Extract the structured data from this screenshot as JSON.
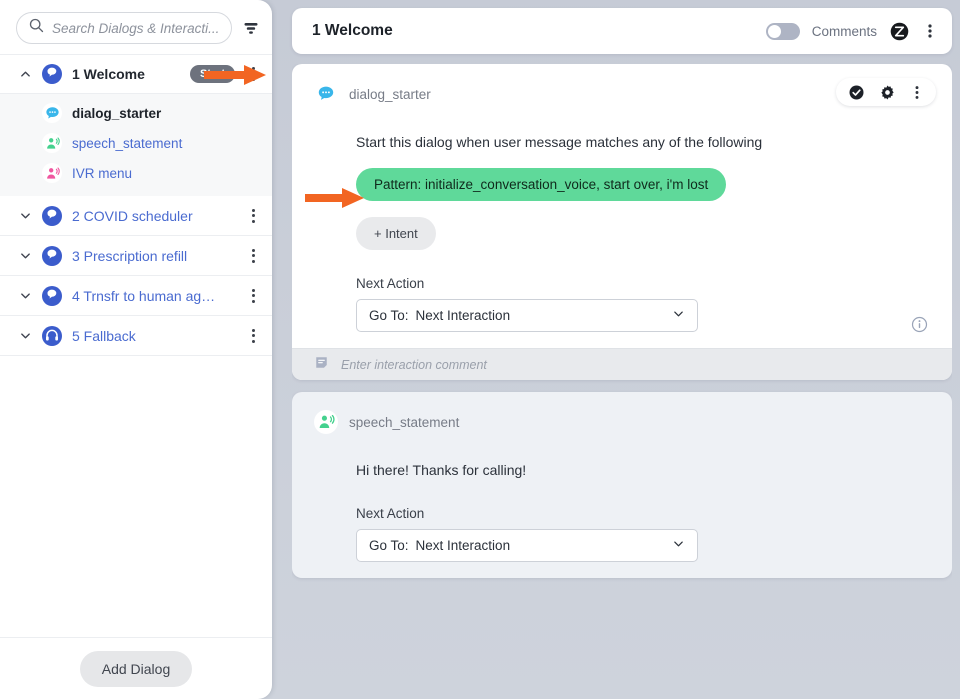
{
  "search": {
    "placeholder": "Search Dialogs & Interacti...",
    "filter_icon": "filter-icon",
    "search_icon": "search-icon"
  },
  "sidebar": {
    "dialogs": [
      {
        "label": "1 Welcome",
        "badge": "Start",
        "expanded": true,
        "icon": "dialog-bubble-icon",
        "children": [
          {
            "label": "dialog_starter",
            "icon": "speech-bubble-blue-icon",
            "selected": true
          },
          {
            "label": "speech_statement",
            "icon": "speaker-person-green-icon",
            "selected": false
          },
          {
            "label": "IVR menu",
            "icon": "speaker-person-pink-icon",
            "selected": false
          }
        ]
      },
      {
        "label": "2 COVID scheduler",
        "badge": "",
        "expanded": false,
        "icon": "dialog-bubble-icon",
        "children": []
      },
      {
        "label": "3 Prescription refill",
        "badge": "",
        "expanded": false,
        "icon": "dialog-bubble-icon",
        "children": []
      },
      {
        "label": "4 Trnsfr to human ag…",
        "badge": "",
        "expanded": false,
        "icon": "dialog-bubble-icon",
        "children": []
      },
      {
        "label": "5 Fallback",
        "badge": "",
        "expanded": false,
        "icon": "headset-icon",
        "children": []
      }
    ],
    "add_dialog_label": "Add Dialog"
  },
  "topbar": {
    "title": "1 Welcome",
    "comments_label": "Comments",
    "comments_toggle_on": false,
    "close_icon": "close-circle-icon",
    "menu_icon": "vertical-dots-icon"
  },
  "cards": [
    {
      "name": "dialog_starter",
      "avatar_icon": "speech-bubble-blue-icon",
      "selected": true,
      "tools": [
        "check-circle-icon",
        "gear-icon",
        "vertical-dots-icon"
      ],
      "description": "Start this dialog when user message matches any of the following",
      "intent_pill": "Pattern:  initialize_conversation_voice, start over, i'm lost",
      "add_intent_label": "+ Intent",
      "next_action_label": "Next Action",
      "next_action_prefix": "Go To:",
      "next_action_value": "Next Interaction",
      "info_icon": "info-icon",
      "footer_placeholder": "Enter interaction comment",
      "footer_icon": "comment-icon"
    },
    {
      "name": "speech_statement",
      "avatar_icon": "speaker-person-green-icon",
      "selected": false,
      "message": "Hi there! Thanks for calling!",
      "next_action_label": "Next Action",
      "next_action_prefix": "Go To:",
      "next_action_value": "Next Interaction"
    }
  ],
  "annotations": {
    "arrow_color": "#f26522",
    "arrow_sidebar_target": "1 Welcome",
    "arrow_pattern_target": "Pattern pill"
  },
  "colors": {
    "accent_blue": "#4a6bd0",
    "intent_green": "#5fd99a",
    "badge_gray": "#6d727d",
    "arrow_orange": "#f26522"
  }
}
